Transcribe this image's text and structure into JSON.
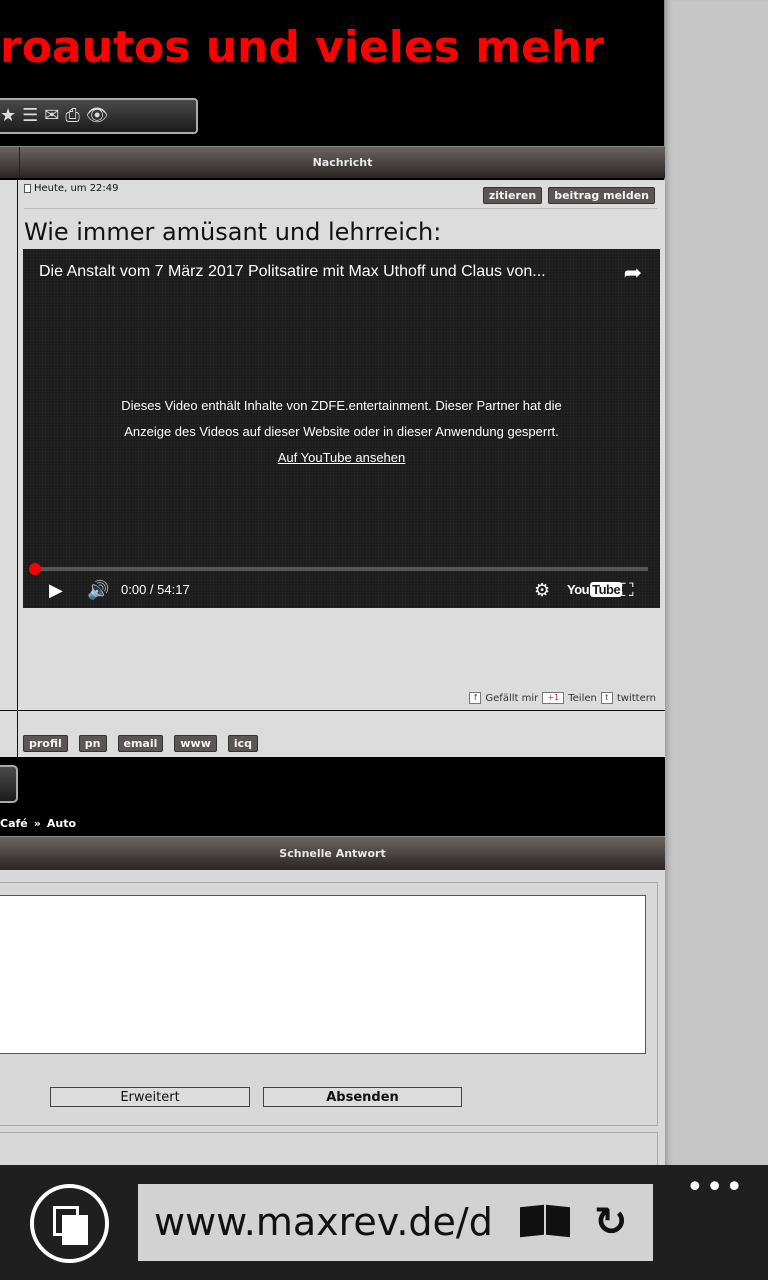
{
  "header": {
    "title_line": "roautos und vieles mehr",
    "icons": [
      "star-icon",
      "list-icon",
      "envelope-icon",
      "printer-icon",
      "eye-icon"
    ]
  },
  "post_table": {
    "header_label": "Nachricht"
  },
  "post": {
    "date": "Heute, um 22:49",
    "quote_label": "zitieren",
    "report_label": "beitrag melden",
    "text": "Wie immer amüsant und lehrreich:",
    "video": {
      "title": "Die Anstalt vom 7 März 2017 Politsatire mit Max Uthoff und Claus von...",
      "message_line1": "Dieses Video enthält Inhalte von ZDFE.entertainment. Dieser Partner hat die",
      "message_line2": "Anzeige des Videos auf dieser Website oder in dieser Anwendung gesperrt.",
      "link_label": "Auf YouTube ansehen",
      "time": "0:00 / 54:17",
      "progress": 0.0
    },
    "social": {
      "like_label": "Gefällt mir",
      "plus_label": "+1",
      "share_label": "Teilen",
      "tweet_label": "twittern"
    }
  },
  "user_actions": [
    "profil",
    "pn",
    "email",
    "www",
    "icq"
  ],
  "breadcrumb": {
    "item1": "Café",
    "separator": "»",
    "item2": "Auto"
  },
  "quick_reply": {
    "header_label": "Schnelle Antwort",
    "textarea_value": "",
    "advanced_label": "Erweitert",
    "send_label": "Absenden"
  },
  "browser": {
    "url": "www.maxrev.de/die",
    "more_label": "•••"
  },
  "colors": {
    "accent_red": "#ff0000",
    "page_background": "#000000",
    "panel_background": "#dcdcdc",
    "appbar_background": "#1f1f1f"
  }
}
